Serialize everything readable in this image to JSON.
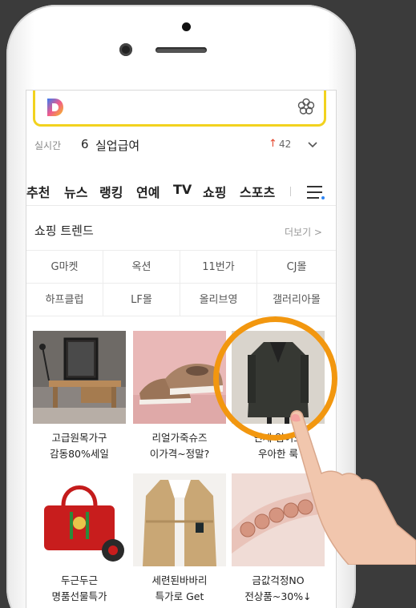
{
  "realtime": {
    "label": "실시간",
    "rank": "6",
    "keyword": "실업급여",
    "trend_arrow": "↑",
    "trend_count": "42"
  },
  "nav": {
    "tabs": [
      "추천",
      "뉴스",
      "랭킹",
      "연예",
      "TV",
      "쇼핑",
      "스포츠"
    ]
  },
  "shopping": {
    "title": "쇼핑 트렌드",
    "more": "더보기 >",
    "malls": [
      "G마켓",
      "옥션",
      "11번가",
      "CJ몰",
      "하프클럽",
      "LF몰",
      "올리브영",
      "갤러리아몰"
    ],
    "products": [
      {
        "line1": "고급원목가구",
        "line2": "감동80%세일"
      },
      {
        "line1": "리얼가죽슈즈",
        "line2": "이가격~정말?"
      },
      {
        "line1": "언제 입어도",
        "line2": "우아한 룩"
      },
      {
        "line1": "두근두근",
        "line2": "명품선물특가"
      },
      {
        "line1": "세련된바바리",
        "line2": "특가로 Get"
      },
      {
        "line1": "금값걱정NO",
        "line2": "전상품~30%↓"
      }
    ]
  },
  "colors": {
    "brand_yellow": "#f2d21e",
    "highlight_orange": "#f2970f",
    "trend_red": "#e4462c"
  },
  "icons": [
    "daum-logo-icon",
    "flower-icon",
    "chevron-down-icon",
    "menu-icon",
    "up-arrow-icon"
  ]
}
